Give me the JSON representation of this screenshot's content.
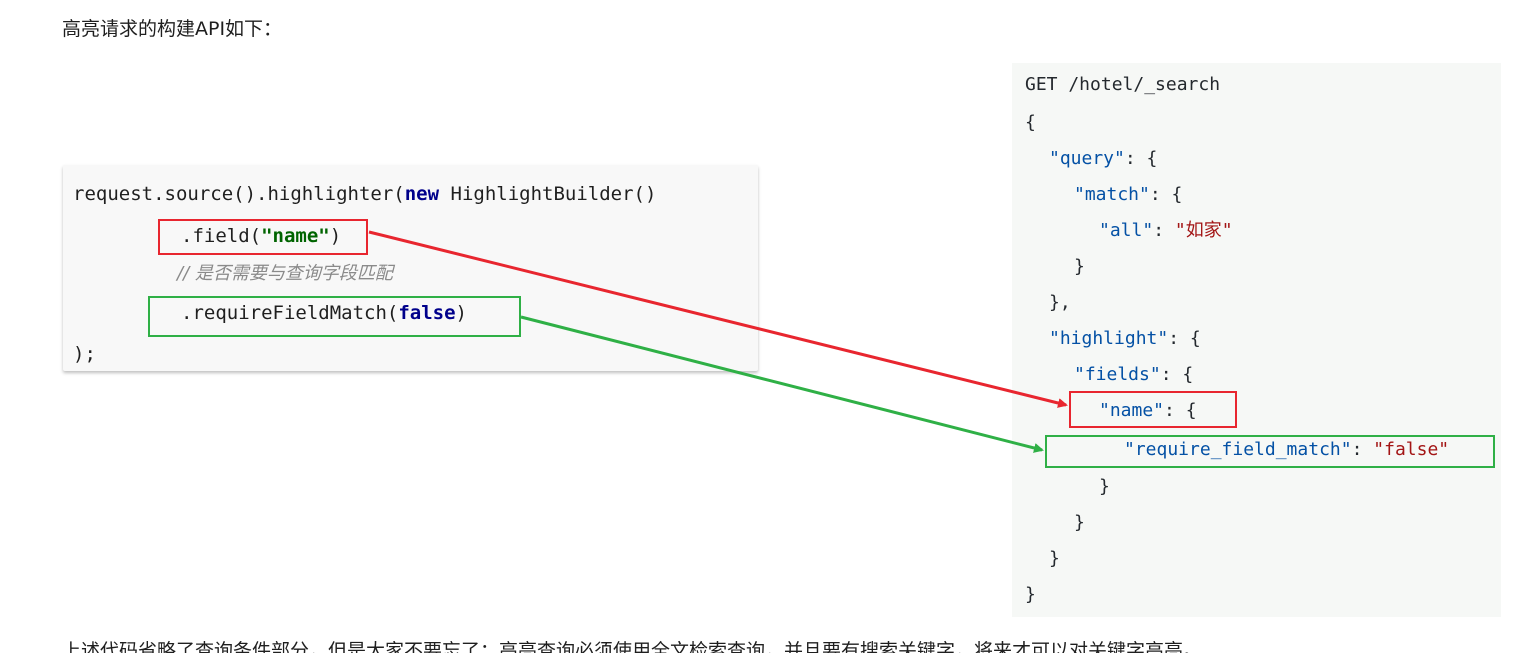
{
  "intro_text": "高亮请求的构建API如下：",
  "footer_text": "上述代码省略了查询条件部分，但是大家不要忘了：高亮查询必须使用全文检索查询，并且要有搜索关键字，将来才可以对关键字高亮。",
  "java_code": {
    "line1_prefix": "request.source().highlighter(",
    "line1_keyword": "new",
    "line1_suffix": " HighlightBuilder()",
    "line2_prefix": ".field(",
    "line2_string": "\"name\"",
    "line2_suffix": ")",
    "line3_comment": "// 是否需要与查询字段匹配",
    "line4_prefix": ".requireFieldMatch(",
    "line4_keyword": "false",
    "line4_suffix": ")",
    "line5": ");"
  },
  "dsl_code": {
    "request_line": "GET /hotel/_search",
    "open_brace": "{",
    "query_key": "\"query\"",
    "match_key": "\"match\"",
    "all_key": "\"all\"",
    "all_value": "\"如家\"",
    "highlight_key": "\"highlight\"",
    "fields_key": "\"fields\"",
    "name_key": "\"name\"",
    "require_key": "\"require_field_match\"",
    "require_value": "\"false\"",
    "colon_brace": ": {",
    "colon_space": ": ",
    "close_brace": "}",
    "close_brace_comma": "},"
  },
  "colors": {
    "red_annotation": "#e8262f",
    "green_annotation": "#2fb046",
    "json_key": "#0451a5",
    "json_string": "#a31515",
    "java_keyword": "#00008b",
    "java_string": "#006400"
  }
}
